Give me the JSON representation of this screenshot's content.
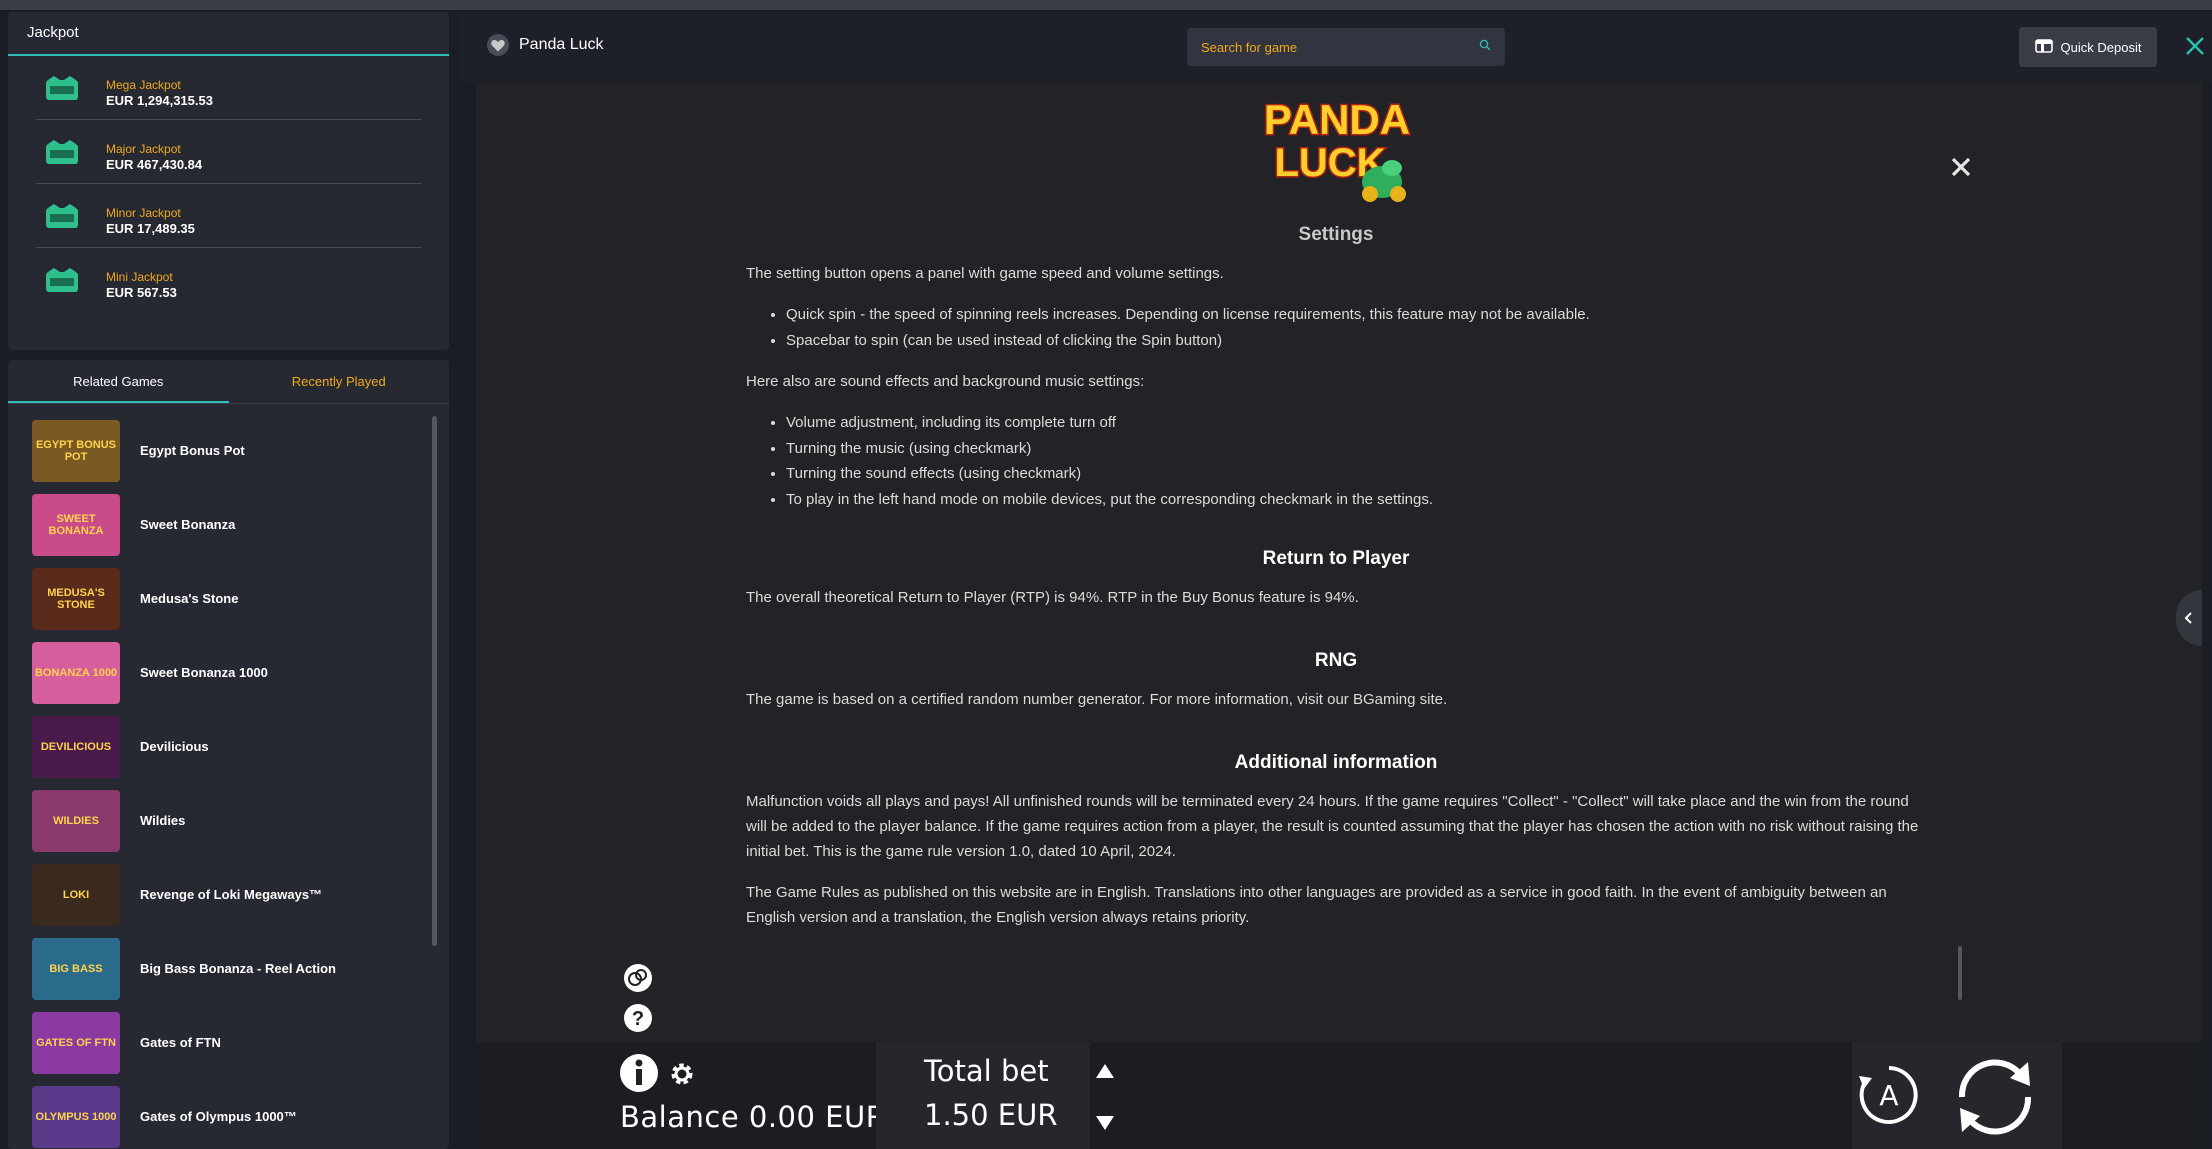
{
  "jackpot": {
    "title": "Jackpot",
    "items": [
      {
        "name": "Mega Jackpot",
        "amount": "EUR 1,294,315.53"
      },
      {
        "name": "Major Jackpot",
        "amount": "EUR 467,430.84"
      },
      {
        "name": "Minor Jackpot",
        "amount": "EUR 17,489.35"
      },
      {
        "name": "Mini Jackpot",
        "amount": "EUR 567.53"
      }
    ],
    "icon": "jackpot-badge-icon"
  },
  "games_panel": {
    "tabs": [
      {
        "label": "Related Games",
        "active": true
      },
      {
        "label": "Recently Played",
        "active": false
      }
    ],
    "games": [
      {
        "title": "Egypt Bonus Pot",
        "thumb_text": "EGYPT BONUS POT",
        "color": "#7a5a22"
      },
      {
        "title": "Sweet Bonanza",
        "thumb_text": "SWEET BONANZA",
        "color": "#c94b8a"
      },
      {
        "title": "Medusa's Stone",
        "thumb_text": "MEDUSA'S STONE",
        "color": "#5a2a1a"
      },
      {
        "title": "Sweet Bonanza 1000",
        "thumb_text": "BONANZA 1000",
        "color": "#d65e9c"
      },
      {
        "title": "Devilicious",
        "thumb_text": "DEVILICIOUS",
        "color": "#4a1a4a"
      },
      {
        "title": "Wildies",
        "thumb_text": "WILDIES",
        "color": "#8a3a6a"
      },
      {
        "title": "Revenge of Loki Megaways™",
        "thumb_text": "LOKI",
        "color": "#3a2a1e"
      },
      {
        "title": "Big Bass Bonanza - Reel Action",
        "thumb_text": "BIG BASS",
        "color": "#2a6a8a"
      },
      {
        "title": "Gates of FTN",
        "thumb_text": "GATES OF FTN",
        "color": "#8a3aa0"
      },
      {
        "title": "Gates of Olympus 1000™",
        "thumb_text": "OLYMPUS 1000",
        "color": "#5a3a8a"
      }
    ]
  },
  "header": {
    "game_name": "Panda Luck",
    "search_placeholder": "Search for game",
    "quick_deposit_label": "Quick Deposit"
  },
  "game": {
    "logo_line1": "PANDA",
    "logo_line2": "LUCK",
    "rules": {
      "settings_title": "Settings",
      "settings_intro": "The setting button opens a panel with game speed and volume settings.",
      "settings_bullets": [
        "Quick spin - the speed of spinning reels increases. Depending on license requirements, this feature may not be available.",
        "Spacebar to spin (can be used instead of clicking the Spin button)"
      ],
      "sound_intro": "Here also are sound effects and background music settings:",
      "sound_bullets": [
        "Volume adjustment, including its complete turn off",
        "Turning the music (using checkmark)",
        "Turning the sound effects (using checkmark)",
        "To play in the left hand mode on mobile devices, put the corresponding checkmark in the settings."
      ],
      "rtp_title": "Return to Player",
      "rtp_text": "The overall theoretical Return to Player (RTP) is 94%. RTP in the Buy Bonus feature is 94%.",
      "rng_title": "RNG",
      "rng_text": "The game is based on a certified random number generator. For more information, visit our BGaming site.",
      "additional_title": "Additional information",
      "additional_text_1": "Malfunction voids all plays and pays! All unfinished rounds will be terminated every 24 hours. If the game requires \"Collect\" - \"Collect\" will take place and the win from the round will be added to the player balance. If the game requires action from a player, the result is counted assuming that the player has chosen the action with no risk without raising the initial bet. This is the game rule version 1.0, dated 10 April, 2024.",
      "additional_text_2": "The Game Rules as published on this website are in English. Translations into other languages are provided as a service in good faith. In the event of ambiguity between an English version and a translation, the English version always retains priority."
    },
    "balance_label": "Balance 0.00 EUR",
    "total_bet_label": "Total bet",
    "total_bet_value": "1.50 EUR"
  },
  "colors": {
    "accent_orange": "#f0a81b",
    "accent_teal": "#2fbfb4",
    "panel_bg": "#262932",
    "page_bg": "#1b1d24"
  }
}
